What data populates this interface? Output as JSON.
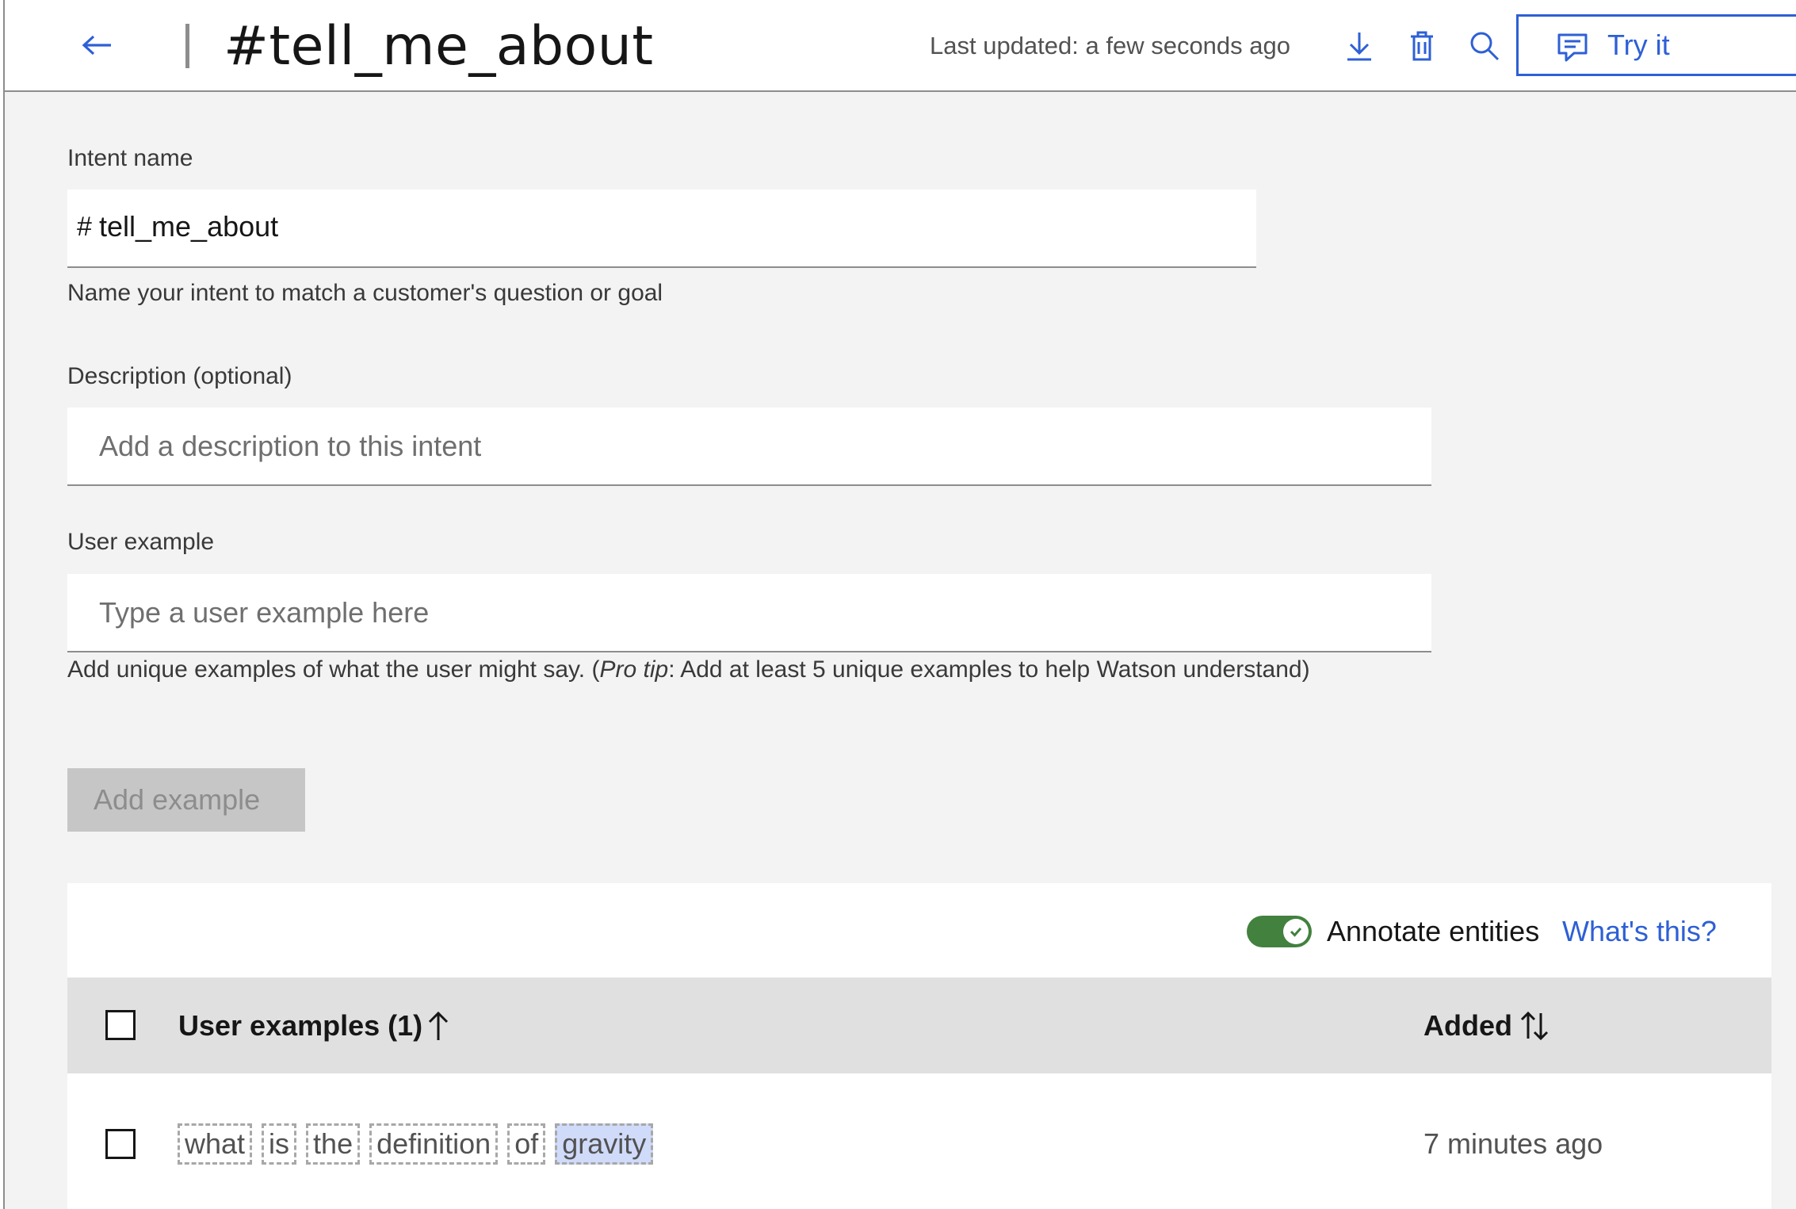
{
  "header": {
    "title": "#tell_me_about",
    "last_updated": "Last updated: a few seconds ago",
    "try_it_label": "Try it",
    "icons": {
      "back": "arrow-left-icon",
      "download": "download-icon",
      "delete": "trash-icon",
      "search": "search-icon",
      "chat": "chat-icon"
    }
  },
  "form": {
    "intent_name_label": "Intent name",
    "intent_prefix": "#",
    "intent_name_value": "tell_me_about",
    "intent_name_helper": "Name your intent to match a customer's question or goal",
    "description_label": "Description (optional)",
    "description_placeholder": "Add a description to this intent",
    "user_example_label": "User example",
    "user_example_placeholder": "Type a user example here",
    "user_example_helper_before": "Add unique examples of what the user might say. (",
    "user_example_helper_italic": "Pro tip",
    "user_example_helper_after": ": Add at least 5 unique examples to help Watson understand)",
    "add_example_label": "Add example"
  },
  "table": {
    "annotate_label": "Annotate entities",
    "annotate_enabled": true,
    "whats_this_label": "What's this?",
    "col_examples": "User examples (1)",
    "col_added": "Added",
    "rows": [
      {
        "tokens": [
          "what",
          "is",
          "the",
          "definition",
          "of",
          "gravity"
        ],
        "highlighted_token": "gravity",
        "added": "7 minutes ago"
      }
    ]
  },
  "colors": {
    "accent": "#2e5fd6",
    "toggle_on": "#42813e",
    "highlight": "#d0dbfa"
  }
}
